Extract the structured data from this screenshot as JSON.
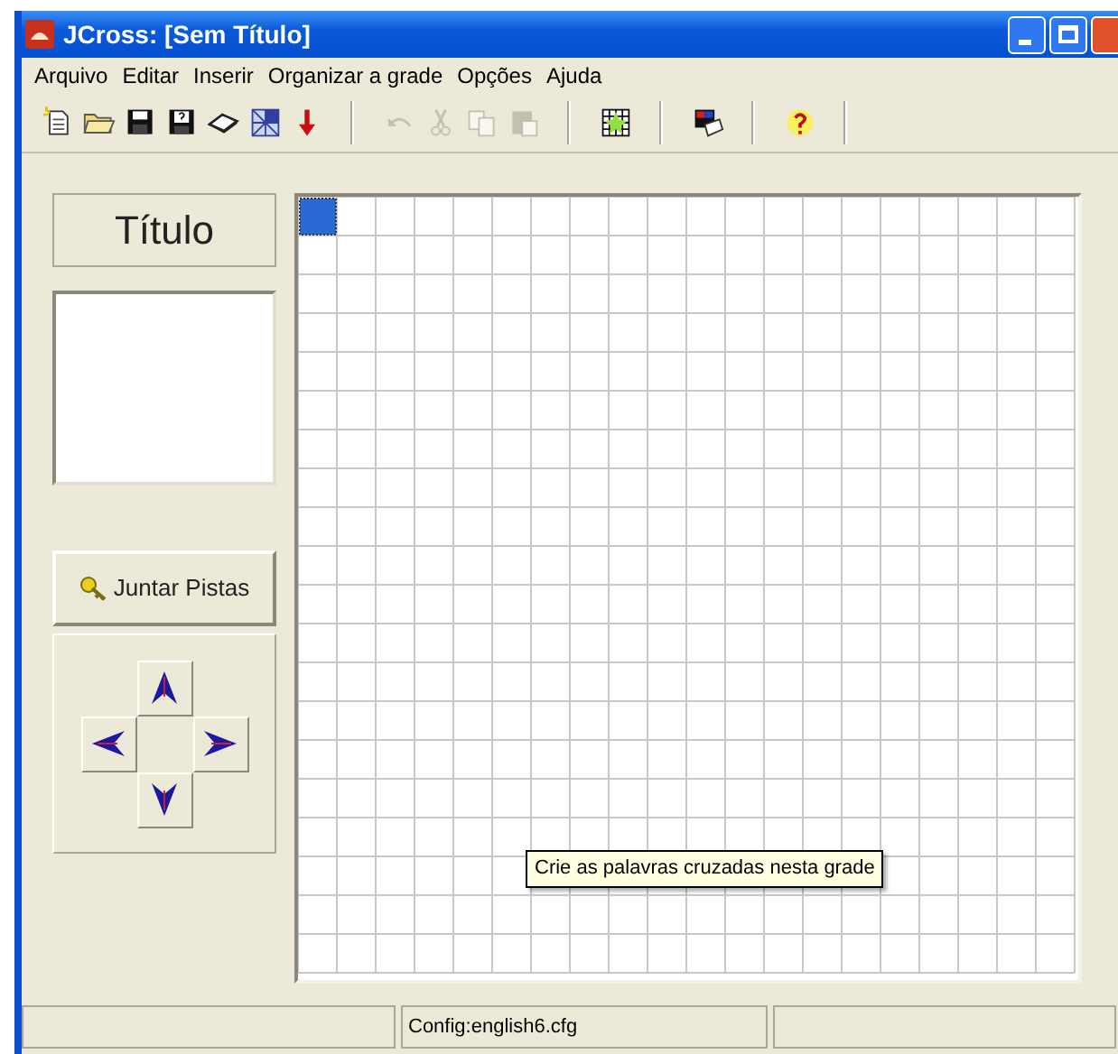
{
  "window": {
    "title": "JCross: [Sem Título]"
  },
  "menu": [
    "Arquivo",
    "Editar",
    "Inserir",
    "Organizar a grade",
    "Opções",
    "Ajuda"
  ],
  "toolbar": [
    [
      {
        "kind": "new",
        "disabled": false
      },
      {
        "kind": "open",
        "disabled": false
      },
      {
        "kind": "save",
        "disabled": false
      },
      {
        "kind": "saveas",
        "disabled": false
      },
      {
        "kind": "book",
        "disabled": false
      },
      {
        "kind": "web",
        "disabled": false
      },
      {
        "kind": "down",
        "disabled": false
      }
    ],
    [
      {
        "kind": "undo",
        "disabled": true
      },
      {
        "kind": "cut",
        "disabled": true
      },
      {
        "kind": "copy",
        "disabled": true
      },
      {
        "kind": "paste",
        "disabled": true
      }
    ],
    [
      {
        "kind": "grid",
        "disabled": false
      }
    ],
    [
      {
        "kind": "colors",
        "disabled": false
      }
    ],
    [
      {
        "kind": "help",
        "disabled": false
      }
    ]
  ],
  "title_button": "Título",
  "clues_button": "Juntar Pistas",
  "tooltip": "Crie as palavras cruzadas nesta grade",
  "status_bar": {
    "config": "Config:english6.cfg"
  }
}
